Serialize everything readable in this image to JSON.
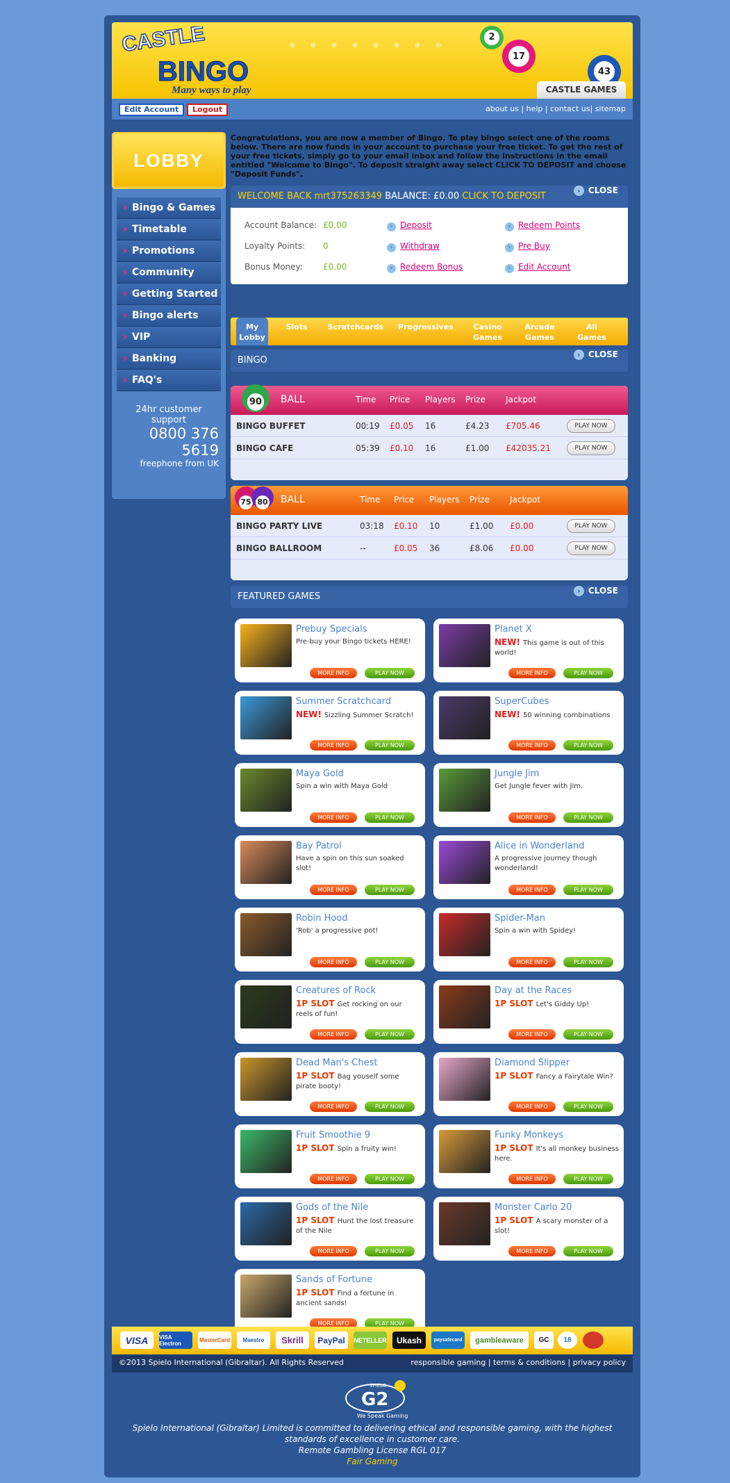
{
  "header": {
    "logo_top": "CASTLE",
    "logo_main": "BINGO",
    "tagline": "Many ways to play",
    "castle_games_tab": "CASTLE GAMES",
    "balls": [
      "2",
      "17",
      "43"
    ]
  },
  "topbar": {
    "edit_account": "Edit Account",
    "logout": "Logout",
    "links": [
      "about us",
      "help",
      "contact us",
      "sitemap"
    ]
  },
  "sidebar": {
    "lobby": "LOBBY",
    "nav": [
      "Bingo & Games",
      "Timetable",
      "Promotions",
      "Community",
      "Getting Started",
      "Bingo alerts",
      "VIP",
      "Banking",
      "FAQ's"
    ],
    "support_title": "24hr customer support",
    "support_phone": "0800 376 5619",
    "support_note": "freephone from UK"
  },
  "intro": "Congratulations, you are now a member of Bingo. To play bingo select one of the rooms below. There are now funds in your account to purchase your free ticket. To get the rest of your free tickets, simply go to your email inbox and follow the instructions in the email entitled \"Welcome to Bingo\". To deposit straight away select CLICK TO DEPOSIT and choose \"Deposit Funds\".",
  "welcome": {
    "welcome_back": "WELCOME BACK mrt375263349",
    "balance": "BALANCE: £0.00",
    "click_to_deposit": "CLICK TO DEPOSIT",
    "close": "CLOSE"
  },
  "account": {
    "rows": [
      {
        "label": "Account Balance:",
        "value": "£0.00",
        "link1": "Deposit",
        "link2": "Redeem Points"
      },
      {
        "label": "Loyalty Points:",
        "value": "0",
        "link1": "Withdraw",
        "link2": "Pre Buy"
      },
      {
        "label": "Bonus Money:",
        "value": "£0.00",
        "link1": "Redeem Bonus",
        "link2": "Edit Account"
      }
    ]
  },
  "tabs": [
    {
      "l1": "My",
      "l2": "Lobby"
    },
    {
      "l1": "Slots",
      "l2": ""
    },
    {
      "l1": "Scratchcards",
      "l2": ""
    },
    {
      "l1": "Progressives",
      "l2": ""
    },
    {
      "l1": "Casino",
      "l2": "Games"
    },
    {
      "l1": "Arcade",
      "l2": "Games"
    },
    {
      "l1": "All",
      "l2": "Games"
    }
  ],
  "bingo": {
    "title": "BINGO",
    "close": "CLOSE",
    "headers": [
      "BALL",
      "Time",
      "Price",
      "Players",
      "Prize",
      "Jackpot"
    ],
    "ball90": "90",
    "ball75": "75",
    "ball80": "80",
    "play_now": "PLAY NOW",
    "rooms90": [
      {
        "name": "BINGO BUFFET",
        "time": "00:19",
        "price": "£0.05",
        "players": "16",
        "prize": "£4.23",
        "jackpot": "£705.46"
      },
      {
        "name": "BINGO CAFE",
        "time": "05:39",
        "price": "£0.10",
        "players": "16",
        "prize": "£1.00",
        "jackpot": "£42035.21"
      }
    ],
    "rooms7580": [
      {
        "name": "BINGO PARTY LIVE",
        "time": "03:18",
        "price": "£0.10",
        "players": "10",
        "prize": "£1.00",
        "jackpot": "£0.00"
      },
      {
        "name": "BINGO BALLROOM",
        "time": "--",
        "price": "£0.05",
        "players": "36",
        "prize": "£8.06",
        "jackpot": "£0.00"
      }
    ]
  },
  "featured": {
    "title": "FEATURED GAMES",
    "close": "CLOSE",
    "more_info": "MORE INFO",
    "play_now": "PLAY NOW",
    "games": [
      {
        "title": "Prebuy Specials",
        "tag": "",
        "desc": "Pre-buy your Bingo tickets HERE!",
        "color": "#f7b21a"
      },
      {
        "title": "Planet X",
        "tag": "NEW!",
        "desc": "This game is out of this world!",
        "color": "#7a3ca8"
      },
      {
        "title": "Summer Scratchcard",
        "tag": "NEW!",
        "desc": "Sizzling Summer Scratch!",
        "color": "#3a9ad8"
      },
      {
        "title": "SuperCubes",
        "tag": "NEW!",
        "desc": "50 winning combinations",
        "color": "#4a3a6a"
      },
      {
        "title": "Maya Gold",
        "tag": "",
        "desc": "Spin a win with Maya Gold",
        "color": "#6a8a2a"
      },
      {
        "title": "Jungle Jim",
        "tag": "",
        "desc": "Get Jungle fever with Jim.",
        "color": "#5a9a3a"
      },
      {
        "title": "Bay Patrol",
        "tag": "",
        "desc": "Have a spin on this sun soaked slot!",
        "color": "#d88a5a"
      },
      {
        "title": "Alice in Wonderland",
        "tag": "",
        "desc": "A progressive journey though wonderland!",
        "color": "#9a4ad8"
      },
      {
        "title": "Robin Hood",
        "tag": "",
        "desc": "'Rob' a progressive pot!",
        "color": "#8a5a2a"
      },
      {
        "title": "Spider-Man",
        "tag": "",
        "desc": "Spin a win with Spidey!",
        "color": "#c82a2a"
      },
      {
        "title": "Creatures of Rock",
        "tag": "1P SLOT",
        "desc": "Get rocking on our reels of fun!",
        "color": "#2a3a1a"
      },
      {
        "title": "Day at the Races",
        "tag": "1P SLOT",
        "desc": "Let's Giddy Up!",
        "color": "#8a3a1a"
      },
      {
        "title": "Dead Man's Chest",
        "tag": "1P SLOT",
        "desc": "Bag youself some pirate booty!",
        "color": "#c8962a"
      },
      {
        "title": "Diamond Slipper",
        "tag": "1P SLOT",
        "desc": "Fancy a Fairytale Win?",
        "color": "#e8a8c8"
      },
      {
        "title": "Fruit Smoothie 9",
        "tag": "1P SLOT",
        "desc": "Spin a fruity win!",
        "color": "#3ab868"
      },
      {
        "title": "Funky Monkeys",
        "tag": "1P SLOT",
        "desc": "It's all monkey business here.",
        "color": "#d89a3a"
      },
      {
        "title": "Gods of the Nile",
        "tag": "1P SLOT",
        "desc": "Hunt the lost treasure of the Nile",
        "color": "#2a6aa8"
      },
      {
        "title": "Monster Carlo 20",
        "tag": "1P SLOT",
        "desc": "A scary monster of a slot!",
        "color": "#6a3a2a"
      },
      {
        "title": "Sands of Fortune",
        "tag": "1P SLOT",
        "desc": "Find a fortune in ancient sands!",
        "color": "#c8a86a"
      }
    ]
  },
  "payments": [
    "VISA",
    "VISA Electron",
    "MasterCard",
    "Maestro",
    "Skrill",
    "PayPal",
    "NETELLER",
    "Ukash",
    "paysafecard",
    "gambleaware",
    "GC",
    "18",
    "seal"
  ],
  "footer": {
    "copyright": "©2013 Spielo International (Gibraltar). All Rights Reserved",
    "links": "responsible gaming | terms & conditions | privacy policy",
    "spielo_small": "SPIELO",
    "spielo_g2": "G2",
    "spielo_tag": "We Speak Gaming",
    "disclaimer1": "Spielo International (Gibraltar) Limited is committed to delivering ethical and responsible gaming, with the highest standards of excellence in customer care.",
    "disclaimer2": "Remote Gambling License RGL 017",
    "fair": "Fair Gaming"
  }
}
